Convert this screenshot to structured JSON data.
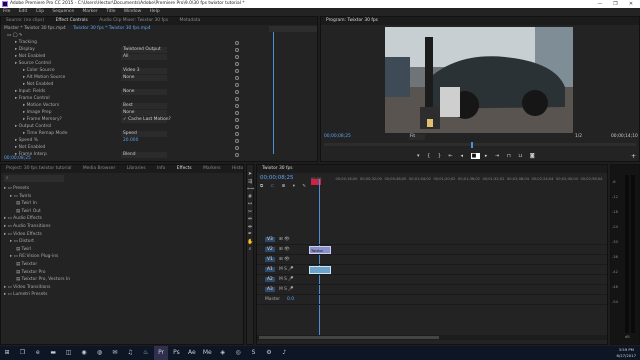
{
  "title_bar": {
    "text": "Adobe Premiere Pro CC 2015 - C:\\Users\\Hector\\Documents\\Adobe\\Premiere Pro\\9.0\\30 fps twixtor tutorial *",
    "min": "—",
    "max": "❐",
    "close": "✕"
  },
  "menu": [
    "File",
    "Edit",
    "Clip",
    "Sequence",
    "Marker",
    "Title",
    "Window",
    "Help"
  ],
  "effect_controls": {
    "tabs": [
      "Source: (no clips)",
      "Effect Controls",
      "Audio Clip Mixer: Twixtor 30 fps",
      "Metadata"
    ],
    "master": "Master * Twixtor 30 fps.mp4",
    "clip": "Twixtor 30 fps * Twixtor 30 fps.mp4",
    "rows": [
      {
        "label": "Tracking",
        "value": "",
        "indent": 1
      },
      {
        "label": "Display",
        "value": "Twixtored Output",
        "indent": 1
      },
      {
        "label": "Not Enabled",
        "value": "All",
        "indent": 1
      },
      {
        "label": "Source Control",
        "value": "",
        "indent": 1
      },
      {
        "label": "Color Source",
        "value": "Video 3",
        "indent": 2
      },
      {
        "label": "Alt Motion Source",
        "value": "None",
        "indent": 2
      },
      {
        "label": "Not Enabled",
        "value": "",
        "indent": 2
      },
      {
        "label": "Input: Fields",
        "value": "None",
        "indent": 1
      },
      {
        "label": "Frame Control",
        "value": "",
        "indent": 1
      },
      {
        "label": "Motion Vectors",
        "value": "Best",
        "indent": 2
      },
      {
        "label": "Image Prep",
        "value": "None",
        "indent": 2
      },
      {
        "label": "Frame Memory?",
        "value": "✓ Cache Last Motion?",
        "indent": 2
      },
      {
        "label": "Output Control",
        "value": "",
        "indent": 1
      },
      {
        "label": "Time Remap Mode",
        "value": "Speed",
        "indent": 2
      },
      {
        "label": "Speed %",
        "value": "20.000",
        "indent": 1
      },
      {
        "label": "Not Enabled",
        "value": "",
        "indent": 1
      },
      {
        "label": "Frame Interp",
        "value": "Blend",
        "indent": 1
      }
    ],
    "timecode": "00;00;08;25"
  },
  "program": {
    "tab": "Program: Twixtor 30 fps",
    "timecode": "00;00;08;25",
    "fit": "Fit",
    "quality": "1/2",
    "duration": "00;00;14;10"
  },
  "project": {
    "tabs": [
      "Project: 30 fps twixtor tutorial",
      "Media Browser",
      "Libraries",
      "Info",
      "Effects",
      "Markers",
      "History"
    ],
    "tree": [
      {
        "label": "Presets",
        "indent": 0
      },
      {
        "label": "Twirls",
        "indent": 1
      },
      {
        "label": "Twirl In",
        "indent": 2
      },
      {
        "label": "Twirl Out",
        "indent": 2
      },
      {
        "label": "Audio Effects",
        "indent": 0
      },
      {
        "label": "Audio Transitions",
        "indent": 0
      },
      {
        "label": "Video Effects",
        "indent": 0
      },
      {
        "label": "Distort",
        "indent": 1
      },
      {
        "label": "Twirl",
        "indent": 2
      },
      {
        "label": "RE:Vision Plug-ins",
        "indent": 1
      },
      {
        "label": "Twixtor",
        "indent": 2
      },
      {
        "label": "Twixtor Pro",
        "indent": 2
      },
      {
        "label": "Twixtor Pro, Vectors In",
        "indent": 2
      },
      {
        "label": "Video Transitions",
        "indent": 0
      },
      {
        "label": "Lumetri Presets",
        "indent": 0
      }
    ]
  },
  "timeline": {
    "tab": "Twixtor 30 fps",
    "timecode": "00;00;08;25",
    "ruler": [
      "00;00",
      "00;00;16;00",
      "00;00;32;00",
      "00;00;48;00",
      "00;01;04;02",
      "00;01;20;02",
      "00;01;36;02",
      "00;01;52;02",
      "00;02;08;04",
      "00;02;24;04",
      "00;02;40;04",
      "00;02;56;04"
    ],
    "tracks": [
      "V3",
      "V2",
      "V1",
      "A1",
      "A2",
      "A3"
    ],
    "master": "Master",
    "master_val": "0.0",
    "clip_label": "Twixtor"
  },
  "meter": {
    "labels": [
      "-6",
      "-12",
      "-18",
      "-24",
      "-30",
      "-36",
      "-42",
      "-48",
      "-54"
    ],
    "unit": "dB"
  },
  "taskbar": {
    "time": "3:59 PM",
    "date": "6/27/2017"
  }
}
